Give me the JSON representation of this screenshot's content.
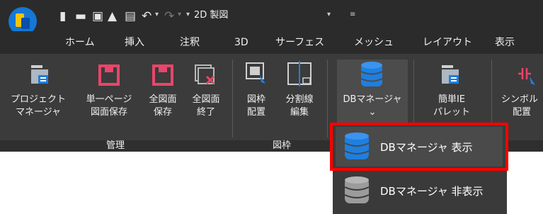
{
  "quick_access": {
    "workspace": "2D 製図",
    "icons": [
      "new-file-icon",
      "open-folder-icon",
      "save-icon",
      "save-as-icon",
      "print-icon",
      "undo-icon",
      "redo-icon",
      "customize-icon"
    ]
  },
  "tabs": [
    "ホーム",
    "挿入",
    "注釈",
    "3D",
    "サーフェス",
    "メッシュ",
    "レイアウト",
    "表示"
  ],
  "ribbon": {
    "buttons": {
      "project_manager": {
        "l1": "プロジェクト",
        "l2": "マネージャ"
      },
      "single_page": {
        "l1": "単一ページ",
        "l2": "図面保存"
      },
      "save_all": {
        "l1": "全図面",
        "l2": "保存"
      },
      "close_all": {
        "l1": "全図面",
        "l2": "終了"
      },
      "frame_place": {
        "l1": "図枠",
        "l2": "配置"
      },
      "split_edit": {
        "l1": "分割線",
        "l2": "編集"
      },
      "db_manager": {
        "l1": "DBマネージャ",
        "l2": "⌄"
      },
      "simple_ie": {
        "l1": "簡単IE",
        "l2": "パレット"
      },
      "symbol_place": {
        "l1": "シンボル",
        "l2": "配置"
      }
    },
    "groups": {
      "manage": "管理",
      "frame": "図枠"
    }
  },
  "dropdown": {
    "show": "DBマネージャ 表示",
    "hide": "DBマネージャ 非表示"
  },
  "colors": {
    "accent": "#1e7fe0",
    "highlight": "#ff0000",
    "pink": "#e8456a"
  }
}
